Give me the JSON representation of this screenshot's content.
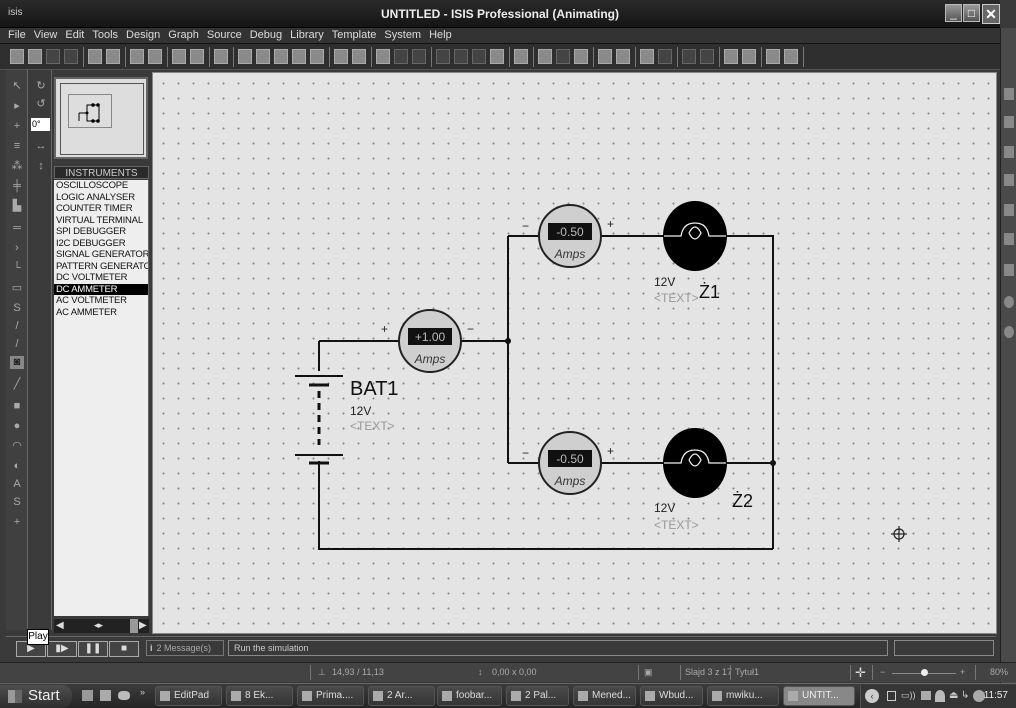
{
  "window": {
    "app_icon_label": "isis",
    "title": "UNTITLED - ISIS Professional (Animating)",
    "minimize_icon": "minimize-icon",
    "maximize_icon": "maximize-icon",
    "close_label": "✕"
  },
  "menu": [
    "File",
    "View",
    "Edit",
    "Tools",
    "Design",
    "Graph",
    "Source",
    "Debug",
    "Library",
    "Template",
    "System",
    "Help"
  ],
  "toolbar": {
    "icons": [
      "new-icon",
      "open-icon",
      "save-icon",
      "import-icon",
      "export-icon",
      "print-icon",
      "print-area-icon",
      "refresh-icon",
      "grid-icon",
      "origin-icon",
      "pan-icon",
      "zoom-in-icon",
      "zoom-out-icon",
      "zoom-all-icon",
      "zoom-area-icon",
      "undo-icon",
      "redo-icon",
      "cut-icon",
      "copy-icon",
      "paste-icon",
      "block-copy-icon",
      "block-move-icon",
      "block-rotate-icon",
      "block-delete-icon",
      "pick-device-icon",
      "make-device-icon",
      "packaging-icon",
      "decompose-icon",
      "wire-autorouter-icon",
      "search-icon",
      "property-assignment-icon",
      "design-explorer-icon",
      "new-sheet-icon",
      "delete-sheet-icon",
      "goto-sheet-icon",
      "zoom-child-icon",
      "bill-of-materials-icon",
      "electrical-rules-icon",
      "netlist-ares-icon"
    ]
  },
  "rotation": {
    "angle_value": "0°"
  },
  "instruments": {
    "header": "INSTRUMENTS",
    "items": [
      "OSCILLOSCOPE",
      "LOGIC ANALYSER",
      "COUNTER TIMER",
      "VIRTUAL TERMINAL",
      "SPI DEBUGGER",
      "I2C DEBUGGER",
      "SIGNAL GENERATOR",
      "PATTERN GENERATOR",
      "DC VOLTMETER",
      "DC AMMETER",
      "AC VOLTMETER",
      "AC AMMETER"
    ],
    "selected": "DC AMMETER"
  },
  "schematic": {
    "battery": {
      "name": "BAT1",
      "value": "12V",
      "text": "<TEXT>"
    },
    "ammeter_main": {
      "reading": "+1.00",
      "unit": "Amps",
      "plus": "+",
      "minus": "−"
    },
    "ammeter_top": {
      "reading": "-0.50",
      "unit": "Amps",
      "plus": "+",
      "minus": "−"
    },
    "ammeter_bottom": {
      "reading": "-0.50",
      "unit": "Amps",
      "plus": "+",
      "minus": "−"
    },
    "lamp_top": {
      "name": "Ż1",
      "value": "12V",
      "text": "<TEXT>"
    },
    "lamp_bottom": {
      "name": "Ż2",
      "value": "12V",
      "text": "<TEXT>"
    }
  },
  "simulation": {
    "play_tooltip": "Play",
    "messages": "2 Message(s)",
    "status": "Run the simulation"
  },
  "statusbar": {
    "coords": "14,93 / 11,13",
    "size": "0,00 x 0,00",
    "slide": "Slajd 3 z 17",
    "title": "Tytuł1",
    "zoom": "80%",
    "zoom_fraction": 0.5
  },
  "taskbar": {
    "start_label": "Start",
    "tasks": [
      "EditPad",
      "8 Ek...",
      "Prima....",
      "2 Ar...",
      "foobar...",
      "2 Pal...",
      "Mened...",
      "Wbud...",
      "mwiku...",
      "UNTIT..."
    ],
    "active_task": "UNTIT...",
    "clock": "11:57"
  }
}
